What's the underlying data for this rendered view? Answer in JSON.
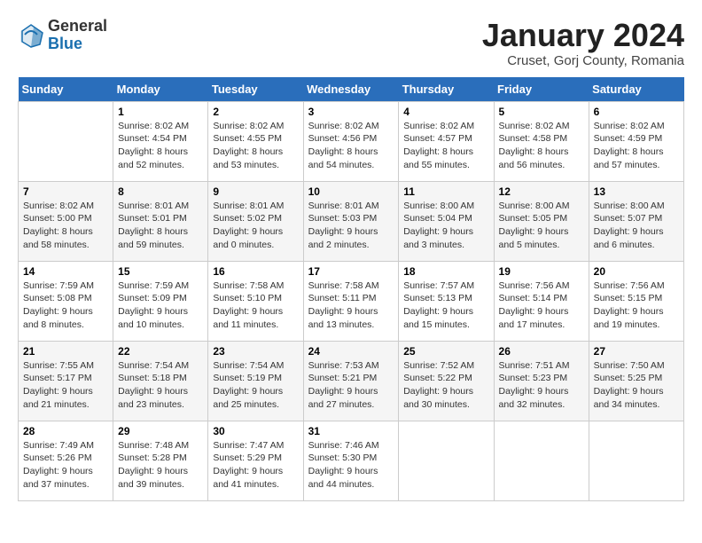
{
  "header": {
    "logo_general": "General",
    "logo_blue": "Blue",
    "title": "January 2024",
    "subtitle": "Cruset, Gorj County, Romania"
  },
  "days_of_week": [
    "Sunday",
    "Monday",
    "Tuesday",
    "Wednesday",
    "Thursday",
    "Friday",
    "Saturday"
  ],
  "weeks": [
    [
      {
        "day": "",
        "info": ""
      },
      {
        "day": "1",
        "info": "Sunrise: 8:02 AM\nSunset: 4:54 PM\nDaylight: 8 hours and 52 minutes."
      },
      {
        "day": "2",
        "info": "Sunrise: 8:02 AM\nSunset: 4:55 PM\nDaylight: 8 hours and 53 minutes."
      },
      {
        "day": "3",
        "info": "Sunrise: 8:02 AM\nSunset: 4:56 PM\nDaylight: 8 hours and 54 minutes."
      },
      {
        "day": "4",
        "info": "Sunrise: 8:02 AM\nSunset: 4:57 PM\nDaylight: 8 hours and 55 minutes."
      },
      {
        "day": "5",
        "info": "Sunrise: 8:02 AM\nSunset: 4:58 PM\nDaylight: 8 hours and 56 minutes."
      },
      {
        "day": "6",
        "info": "Sunrise: 8:02 AM\nSunset: 4:59 PM\nDaylight: 8 hours and 57 minutes."
      }
    ],
    [
      {
        "day": "7",
        "info": "Sunrise: 8:02 AM\nSunset: 5:00 PM\nDaylight: 8 hours and 58 minutes."
      },
      {
        "day": "8",
        "info": "Sunrise: 8:01 AM\nSunset: 5:01 PM\nDaylight: 8 hours and 59 minutes."
      },
      {
        "day": "9",
        "info": "Sunrise: 8:01 AM\nSunset: 5:02 PM\nDaylight: 9 hours and 0 minutes."
      },
      {
        "day": "10",
        "info": "Sunrise: 8:01 AM\nSunset: 5:03 PM\nDaylight: 9 hours and 2 minutes."
      },
      {
        "day": "11",
        "info": "Sunrise: 8:00 AM\nSunset: 5:04 PM\nDaylight: 9 hours and 3 minutes."
      },
      {
        "day": "12",
        "info": "Sunrise: 8:00 AM\nSunset: 5:05 PM\nDaylight: 9 hours and 5 minutes."
      },
      {
        "day": "13",
        "info": "Sunrise: 8:00 AM\nSunset: 5:07 PM\nDaylight: 9 hours and 6 minutes."
      }
    ],
    [
      {
        "day": "14",
        "info": "Sunrise: 7:59 AM\nSunset: 5:08 PM\nDaylight: 9 hours and 8 minutes."
      },
      {
        "day": "15",
        "info": "Sunrise: 7:59 AM\nSunset: 5:09 PM\nDaylight: 9 hours and 10 minutes."
      },
      {
        "day": "16",
        "info": "Sunrise: 7:58 AM\nSunset: 5:10 PM\nDaylight: 9 hours and 11 minutes."
      },
      {
        "day": "17",
        "info": "Sunrise: 7:58 AM\nSunset: 5:11 PM\nDaylight: 9 hours and 13 minutes."
      },
      {
        "day": "18",
        "info": "Sunrise: 7:57 AM\nSunset: 5:13 PM\nDaylight: 9 hours and 15 minutes."
      },
      {
        "day": "19",
        "info": "Sunrise: 7:56 AM\nSunset: 5:14 PM\nDaylight: 9 hours and 17 minutes."
      },
      {
        "day": "20",
        "info": "Sunrise: 7:56 AM\nSunset: 5:15 PM\nDaylight: 9 hours and 19 minutes."
      }
    ],
    [
      {
        "day": "21",
        "info": "Sunrise: 7:55 AM\nSunset: 5:17 PM\nDaylight: 9 hours and 21 minutes."
      },
      {
        "day": "22",
        "info": "Sunrise: 7:54 AM\nSunset: 5:18 PM\nDaylight: 9 hours and 23 minutes."
      },
      {
        "day": "23",
        "info": "Sunrise: 7:54 AM\nSunset: 5:19 PM\nDaylight: 9 hours and 25 minutes."
      },
      {
        "day": "24",
        "info": "Sunrise: 7:53 AM\nSunset: 5:21 PM\nDaylight: 9 hours and 27 minutes."
      },
      {
        "day": "25",
        "info": "Sunrise: 7:52 AM\nSunset: 5:22 PM\nDaylight: 9 hours and 30 minutes."
      },
      {
        "day": "26",
        "info": "Sunrise: 7:51 AM\nSunset: 5:23 PM\nDaylight: 9 hours and 32 minutes."
      },
      {
        "day": "27",
        "info": "Sunrise: 7:50 AM\nSunset: 5:25 PM\nDaylight: 9 hours and 34 minutes."
      }
    ],
    [
      {
        "day": "28",
        "info": "Sunrise: 7:49 AM\nSunset: 5:26 PM\nDaylight: 9 hours and 37 minutes."
      },
      {
        "day": "29",
        "info": "Sunrise: 7:48 AM\nSunset: 5:28 PM\nDaylight: 9 hours and 39 minutes."
      },
      {
        "day": "30",
        "info": "Sunrise: 7:47 AM\nSunset: 5:29 PM\nDaylight: 9 hours and 41 minutes."
      },
      {
        "day": "31",
        "info": "Sunrise: 7:46 AM\nSunset: 5:30 PM\nDaylight: 9 hours and 44 minutes."
      },
      {
        "day": "",
        "info": ""
      },
      {
        "day": "",
        "info": ""
      },
      {
        "day": "",
        "info": ""
      }
    ]
  ]
}
